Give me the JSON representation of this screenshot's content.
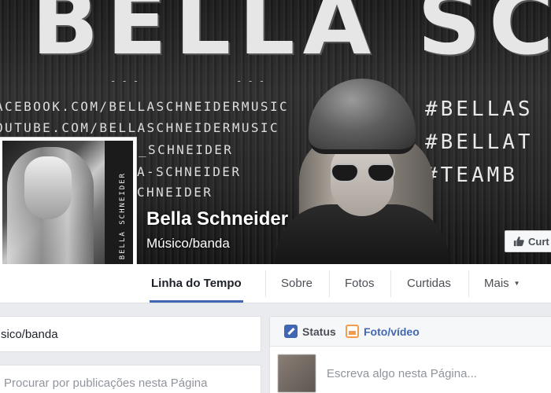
{
  "cover": {
    "title": "BELLA SCHNEIDER",
    "dashes": "- - -",
    "social_lines": [
      "ACEBOOK.COM/BELLASCHNEIDERMUSIC",
      "OUTUBE.COM/BELLASCHNEIDERMUSIC",
      "_SCHNEIDER",
      "A-SCHNEIDER",
      "CHNEIDER"
    ],
    "hashtags": [
      "#BELLAS",
      "#BELLAT",
      "#TEAMB"
    ]
  },
  "page": {
    "name": "Bella Schneider",
    "category": "Músico/banda"
  },
  "profile_picture": {
    "vertical_text": "BELLA SCHNEIDER"
  },
  "like_button": {
    "label": "Curt"
  },
  "nav": {
    "tabs": [
      {
        "label": "Linha do Tempo",
        "active": true
      },
      {
        "label": "Sobre",
        "active": false
      },
      {
        "label": "Fotos",
        "active": false
      },
      {
        "label": "Curtidas",
        "active": false
      },
      {
        "label": "Mais",
        "active": false
      }
    ],
    "more_caret": "▼"
  },
  "left": {
    "category_text": "sico/banda",
    "search_placeholder": "Procurar por publicações nesta Página"
  },
  "composer": {
    "tabs": [
      {
        "label": "Status",
        "icon": "pencil-icon"
      },
      {
        "label": "Foto/vídeo",
        "icon": "photo-icon"
      }
    ],
    "input_placeholder": "Escreva algo nesta Página..."
  },
  "colors": {
    "accent": "#4267b2",
    "background": "#e9ebee",
    "photo_icon": "#f39c4f"
  }
}
